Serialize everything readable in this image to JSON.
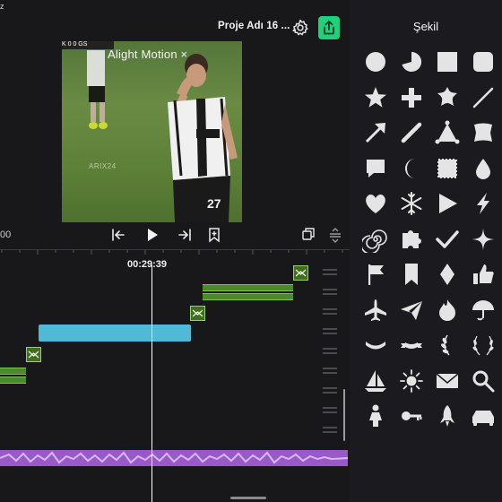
{
  "topbar": {
    "corner_mark": "z",
    "project_title": "Proje Adı 16 ...",
    "icons": [
      "gear-icon",
      "export-icon"
    ]
  },
  "preview": {
    "watermark": "Alight Motion ×",
    "scoreboard": "K 0 0 GS",
    "credit": "ARIX24"
  },
  "transport": {
    "left_time": "00",
    "icons": [
      "skip-back-icon",
      "play-icon",
      "skip-forward-icon",
      "bookmark-icon",
      "copy-icon",
      "menu-icon"
    ]
  },
  "timeline": {
    "current_time": "00:29:39"
  },
  "sidebar": {
    "title": "Şekil",
    "shapes": [
      "circle",
      "pie",
      "square",
      "rounded-square",
      "star",
      "plus",
      "flower-star",
      "line",
      "arrow",
      "pencil-line",
      "triangle-pin",
      "scroll",
      "speech-bubble",
      "crescent",
      "stamp",
      "drop",
      "heart",
      "snowflake",
      "play-triangle",
      "lightning",
      "spiral",
      "puzzle",
      "checkmark",
      "sparkle",
      "flag",
      "bookmark",
      "diamond",
      "thumbs-up",
      "airplane",
      "paper-plane",
      "flame",
      "umbrella",
      "banner-curve",
      "banner-ribbon",
      "laurel-left",
      "laurel-wreath",
      "sailboat",
      "sun",
      "envelope",
      "magnifier",
      "person",
      "key",
      "rocket",
      "car"
    ]
  },
  "colors": {
    "accent_export": "#21d07a",
    "clip_blue": "#4fb9d6",
    "clip_green": "#4a8a2c",
    "audio_purple": "#9a59c9",
    "background": "#18181b"
  }
}
